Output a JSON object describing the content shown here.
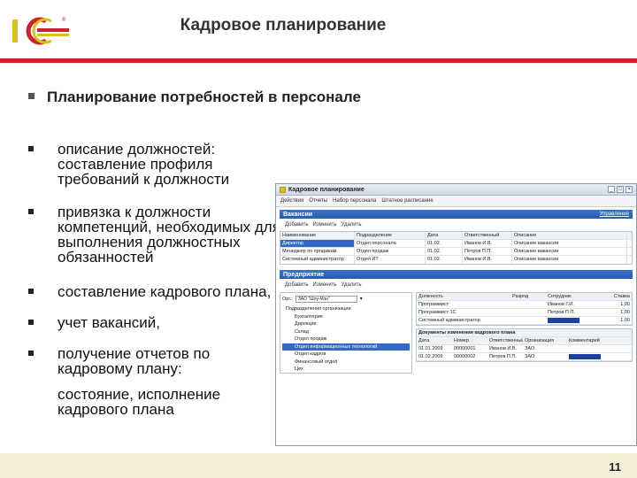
{
  "header": {
    "logo_text": "1C",
    "title": "Кадровое планирование",
    "accent_color": "#c9252c"
  },
  "heading": "Планирование потребностей в персонале",
  "bullets": [
    {
      "text": "описание должностей: составление профиля требований к должности"
    },
    {
      "text": "привязка к должности компетенций, необходимых для выполнения должностных обязанностей"
    },
    {
      "text": "составление кадрового плана,"
    },
    {
      "text": "учет вакансий,"
    },
    {
      "text": "получение отчетов по кадровому плану:"
    },
    {
      "text": "состояние, исполнение кадрового плана"
    }
  ],
  "page_number": "11",
  "window": {
    "title": "Кадровое планирование",
    "toolbar": [
      "Действия",
      "Отчеты",
      "Набор персонала",
      "Штатное расписание"
    ],
    "section1": {
      "label": "Вакансии",
      "right_link": "Управление"
    },
    "subtool1": [
      "Добавить",
      "Изменить",
      "Удалить"
    ],
    "vacancies": {
      "headers": [
        "Наименование",
        "Подразделение",
        "Дата",
        "Ответственный",
        "Описание"
      ],
      "rows": [
        [
          "Директор",
          "Отдел персонала",
          "01.02.",
          "Иванов И.В.",
          "Описание вакансии"
        ],
        [
          "Менеджер по продажам",
          "Отдел продаж",
          "01.02.",
          "Петров П.П.",
          "Описание вакансии"
        ],
        [
          "Системный администратор",
          "Отдел ИТ",
          "01.02.",
          "Иванов И.В.",
          "Описание вакансии"
        ]
      ]
    },
    "section2": {
      "label": "Предприятие"
    },
    "subtool2": [
      "Добавить",
      "Изменить",
      "Удалить"
    ],
    "org_select": "ЗАО \"Шоу-Мэн\"",
    "tree": [
      {
        "text": "Подразделения организации",
        "root": true
      },
      {
        "text": "Бухгалтерия"
      },
      {
        "text": "Дирекция"
      },
      {
        "text": "Склад"
      },
      {
        "text": "Отдел продаж"
      },
      {
        "text": "Отдел информационных технологий",
        "hl": true
      },
      {
        "text": "Отдел кадров"
      },
      {
        "text": "Финансовый отдел"
      },
      {
        "text": "Цех"
      }
    ],
    "positions": {
      "headers": [
        "Должность",
        "Разряд",
        "Сотрудник",
        "Ставка"
      ],
      "rows": [
        [
          "Программист",
          "",
          "Иванов Г.И.",
          "1,00"
        ],
        [
          "Программист 1С",
          "",
          "Петров П.П.",
          "1,00"
        ],
        [
          "Системный администратор",
          "",
          "",
          "1,00"
        ]
      ]
    },
    "docs": {
      "title": "Документы изменения кадрового плана",
      "headers": [
        "Дата",
        "Номер",
        "Ответственный",
        "Организация",
        "Комментарий"
      ],
      "rows": [
        [
          "01.01.2009",
          "00000001",
          "Иванов И.В.",
          "ЗАО",
          ""
        ],
        [
          "01.02.2009",
          "00000002",
          "Петров П.П.",
          "ЗАО",
          ""
        ]
      ]
    }
  }
}
